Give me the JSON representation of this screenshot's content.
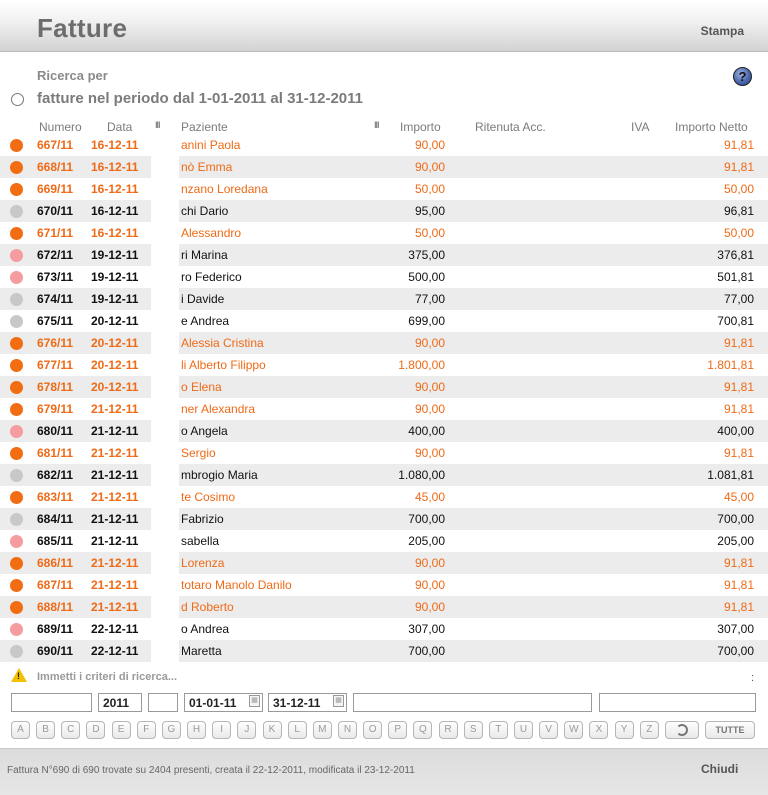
{
  "header": {
    "title": "Fatture",
    "print_label": "Stampa"
  },
  "search": {
    "label": "Ricerca per",
    "period_text": "fatture nel periodo dal 1-01-2011 al 31-12-2011",
    "help_icon": "?"
  },
  "columns": {
    "numero": "Numero",
    "data": "Data",
    "paziente": "Paziente",
    "importo": "Importo",
    "ritenuta": "Ritenuta Acc.",
    "iva": "IVA",
    "netto": "Importo Netto",
    "grip_icon": "III"
  },
  "colors": {
    "orange": "#f26d12",
    "grey": "#c8c8c8",
    "pink": "#f59ca0"
  },
  "rows": [
    {
      "status": "orange",
      "numero": "667/11",
      "data": "16-12-11",
      "paziente": "anini Paola",
      "importo": "90,00",
      "netto": "91,81"
    },
    {
      "status": "orange",
      "numero": "668/11",
      "data": "16-12-11",
      "paziente": "nò Emma",
      "importo": "90,00",
      "netto": "91,81"
    },
    {
      "status": "orange",
      "numero": "669/11",
      "data": "16-12-11",
      "paziente": "nzano Loredana",
      "importo": "50,00",
      "netto": "50,00"
    },
    {
      "status": "grey",
      "numero": "670/11",
      "data": "16-12-11",
      "paziente": "chi Dario",
      "importo": "95,00",
      "netto": "96,81"
    },
    {
      "status": "orange",
      "numero": "671/11",
      "data": "16-12-11",
      "paziente": "Alessandro",
      "importo": "50,00",
      "netto": "50,00"
    },
    {
      "status": "pink",
      "numero": "672/11",
      "data": "19-12-11",
      "paziente": "ri Marina",
      "importo": "375,00",
      "netto": "376,81"
    },
    {
      "status": "pink",
      "numero": "673/11",
      "data": "19-12-11",
      "paziente": "ro Federico",
      "importo": "500,00",
      "netto": "501,81"
    },
    {
      "status": "grey",
      "numero": "674/11",
      "data": "19-12-11",
      "paziente": "i Davide",
      "importo": "77,00",
      "netto": "77,00"
    },
    {
      "status": "grey",
      "numero": "675/11",
      "data": "20-12-11",
      "paziente": "e Andrea",
      "importo": "699,00",
      "netto": "700,81"
    },
    {
      "status": "orange",
      "numero": "676/11",
      "data": "20-12-11",
      "paziente": "Alessia Cristina",
      "importo": "90,00",
      "netto": "91,81"
    },
    {
      "status": "orange",
      "numero": "677/11",
      "data": "20-12-11",
      "paziente": "li Alberto Filippo",
      "importo": "1.800,00",
      "netto": "1.801,81"
    },
    {
      "status": "orange",
      "numero": "678/11",
      "data": "20-12-11",
      "paziente": "o Elena",
      "importo": "90,00",
      "netto": "91,81"
    },
    {
      "status": "orange",
      "numero": "679/11",
      "data": "21-12-11",
      "paziente": "ner Alexandra",
      "importo": "90,00",
      "netto": "91,81"
    },
    {
      "status": "pink",
      "numero": "680/11",
      "data": "21-12-11",
      "paziente": "o Angela",
      "importo": "400,00",
      "netto": "400,00"
    },
    {
      "status": "orange",
      "numero": "681/11",
      "data": "21-12-11",
      "paziente": "Sergio",
      "importo": "90,00",
      "netto": "91,81"
    },
    {
      "status": "grey",
      "numero": "682/11",
      "data": "21-12-11",
      "paziente": "mbrogio Maria",
      "importo": "1.080,00",
      "netto": "1.081,81"
    },
    {
      "status": "orange",
      "numero": "683/11",
      "data": "21-12-11",
      "paziente": "te Cosimo",
      "importo": "45,00",
      "netto": "45,00"
    },
    {
      "status": "grey",
      "numero": "684/11",
      "data": "21-12-11",
      "paziente": "Fabrizio",
      "importo": "700,00",
      "netto": "700,00"
    },
    {
      "status": "pink",
      "numero": "685/11",
      "data": "21-12-11",
      "paziente": "sabella",
      "importo": "205,00",
      "netto": "205,00"
    },
    {
      "status": "orange",
      "numero": "686/11",
      "data": "21-12-11",
      "paziente": "Lorenza",
      "importo": "90,00",
      "netto": "91,81"
    },
    {
      "status": "orange",
      "numero": "687/11",
      "data": "21-12-11",
      "paziente": "totaro Manolo Danilo",
      "importo": "90,00",
      "netto": "91,81"
    },
    {
      "status": "orange",
      "numero": "688/11",
      "data": "21-12-11",
      "paziente": "d Roberto",
      "importo": "90,00",
      "netto": "91,81"
    },
    {
      "status": "pink",
      "numero": "689/11",
      "data": "22-12-11",
      "paziente": "o Andrea",
      "importo": "307,00",
      "netto": "307,00"
    },
    {
      "status": "grey",
      "numero": "690/11",
      "data": "22-12-11",
      "paziente": "Maretta",
      "importo": "700,00",
      "netto": "700,00"
    }
  ],
  "warning": {
    "icon": "warning-icon",
    "mark": "!",
    "text": "Immetti i criteri di ricerca...",
    "colon": ":"
  },
  "filters": {
    "field1": "",
    "year": "2011",
    "field3": "",
    "date_from": "01-01-11",
    "date_to": "31-12-11",
    "field6": "",
    "field7": ""
  },
  "letters": [
    "A",
    "B",
    "C",
    "D",
    "E",
    "F",
    "G",
    "H",
    "I",
    "J",
    "K",
    "L",
    "M",
    "N",
    "O",
    "P",
    "Q",
    "R",
    "S",
    "T",
    "U",
    "V",
    "W",
    "X",
    "Y",
    "Z"
  ],
  "tutte_label": "TUTTE",
  "footer": {
    "status": "Fattura N°690 di 690 trovate su 2404 presenti, creata il 22-12-2011, modificata il 23-12-2011",
    "close_label": "Chiudi"
  }
}
